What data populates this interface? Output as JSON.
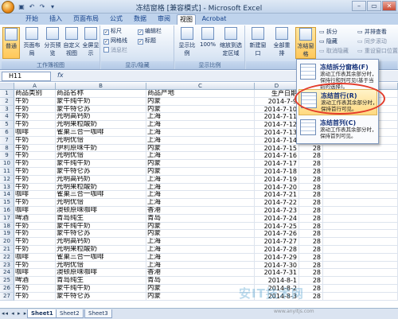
{
  "window": {
    "title": "冻结窗格 [兼容模式] - Microsoft Excel",
    "controls": [
      "–",
      "▭",
      "✕"
    ]
  },
  "tabs": [
    "开始",
    "插入",
    "页面布局",
    "公式",
    "数据",
    "审阅",
    "视图",
    "Acrobat"
  ],
  "active_tab": "视图",
  "ribbon": {
    "view_group": {
      "label": "工作簿视图",
      "buttons": [
        "普通",
        "页面布局",
        "分页预览",
        "自定义视图",
        "全屏显示"
      ]
    },
    "show_group": {
      "label": "显示/隐藏",
      "items": [
        {
          "label": "标尺",
          "checked": true
        },
        {
          "label": "编辑栏",
          "checked": true
        },
        {
          "label": "网格线",
          "checked": true
        },
        {
          "label": "标题",
          "checked": true
        },
        {
          "label": "消息栏",
          "checked": false
        }
      ]
    },
    "zoom_group": {
      "label": "显示比例",
      "buttons": [
        "显示比例",
        "100%",
        "缩放到选定区域"
      ]
    },
    "window_group": {
      "buttons": [
        "新建窗口",
        "全部重排",
        "冻结窗格"
      ],
      "small": [
        "拆分",
        "隐藏",
        "取消隐藏"
      ],
      "right": [
        "并排查看",
        "同步滚动",
        "重设窗口位置"
      ]
    }
  },
  "formula_bar": {
    "name_box": "H11",
    "fx": "fx",
    "content": ""
  },
  "columns": [
    "A",
    "B",
    "C",
    "D"
  ],
  "table": {
    "rows": [
      [
        "商品类别",
        "商品名称",
        "商品产地",
        "生产日期",
        "",
        ""
      ],
      [
        "牛奶",
        "蒙牛纯牛奶",
        "内蒙",
        "2014-7-9",
        "",
        "28"
      ],
      [
        "牛奶",
        "蒙牛特仑苏",
        "内蒙",
        "2014-7-10",
        "",
        "28"
      ],
      [
        "牛奶",
        "光明高钙奶",
        "上海",
        "2014-7-11",
        "",
        "28"
      ],
      [
        "牛奶",
        "光明果粒酸奶",
        "上海",
        "2014-7-12",
        "",
        "28"
      ],
      [
        "咖啡",
        "雀巢三合一咖啡",
        "上海",
        "2014-7-13",
        "",
        "28"
      ],
      [
        "牛奶",
        "光明优倍",
        "上海",
        "2014-7-14",
        "",
        "28"
      ],
      [
        "牛奶",
        "伊利原味牛奶",
        "内蒙",
        "2014-7-15",
        "",
        "28"
      ],
      [
        "牛奶",
        "光明优倍",
        "上海",
        "2014-7-16",
        "",
        "28"
      ],
      [
        "牛奶",
        "蒙牛纯牛奶",
        "内蒙",
        "2014-7-17",
        "",
        "28"
      ],
      [
        "牛奶",
        "蒙牛特仑苏",
        "内蒙",
        "2014-7-18",
        "",
        "28"
      ],
      [
        "牛奶",
        "光明高钙奶",
        "上海",
        "2014-7-19",
        "",
        "28"
      ],
      [
        "牛奶",
        "光明果粒酸奶",
        "上海",
        "2014-7-20",
        "",
        "28"
      ],
      [
        "咖啡",
        "雀巢三合一咖啡",
        "上海",
        "2014-7-21",
        "",
        "28"
      ],
      [
        "牛奶",
        "光明优倍",
        "上海",
        "2014-7-22",
        "",
        "28"
      ],
      [
        "咖啡",
        "澳顿原味咖啡",
        "香港",
        "2014-7-23",
        "",
        "28"
      ],
      [
        "啤酒",
        "青岛纯生",
        "青岛",
        "2014-7-24",
        "",
        "28"
      ],
      [
        "牛奶",
        "蒙牛纯牛奶",
        "内蒙",
        "2014-7-25",
        "",
        "28"
      ],
      [
        "牛奶",
        "蒙牛特仑苏",
        "内蒙",
        "2014-7-26",
        "",
        "28"
      ],
      [
        "牛奶",
        "光明高钙奶",
        "上海",
        "2014-7-27",
        "",
        "28"
      ],
      [
        "牛奶",
        "光明果粒酸奶",
        "上海",
        "2014-7-28",
        "",
        "28"
      ],
      [
        "咖啡",
        "雀巢三合一咖啡",
        "上海",
        "2014-7-29",
        "",
        "28"
      ],
      [
        "牛奶",
        "光明优倍",
        "上海",
        "2014-7-30",
        "",
        "28"
      ],
      [
        "咖啡",
        "澳顿原味咖啡",
        "香港",
        "2014-7-31",
        "",
        "28"
      ],
      [
        "啤酒",
        "青岛纯生",
        "青岛",
        "2014-8-1",
        "",
        "28"
      ],
      [
        "牛奶",
        "蒙牛纯牛奶",
        "内蒙",
        "2014-8-2",
        "",
        "28"
      ],
      [
        "牛奶",
        "蒙牛特仑苏",
        "内蒙",
        "2014-8-3",
        "",
        "28"
      ]
    ]
  },
  "sheets": [
    "Sheet1",
    "Sheet2",
    "Sheet3"
  ],
  "active_sheet": "Sheet1",
  "freeze_menu": {
    "items": [
      {
        "title": "冻结拆分窗格(F)",
        "desc": "滚动工作表其余部分时，保持行和列可见(基于当前的选择)。"
      },
      {
        "title": "冻结首行(R)",
        "desc": "滚动工作表其余部分时，保持首行可见。"
      },
      {
        "title": "冻结首列(C)",
        "desc": "滚动工作表其余部分时，保持首列可见。"
      }
    ],
    "highlighted_index": 1
  },
  "watermark": {
    "text": "安IT技术网",
    "sub": "www.anyitjs.com"
  }
}
